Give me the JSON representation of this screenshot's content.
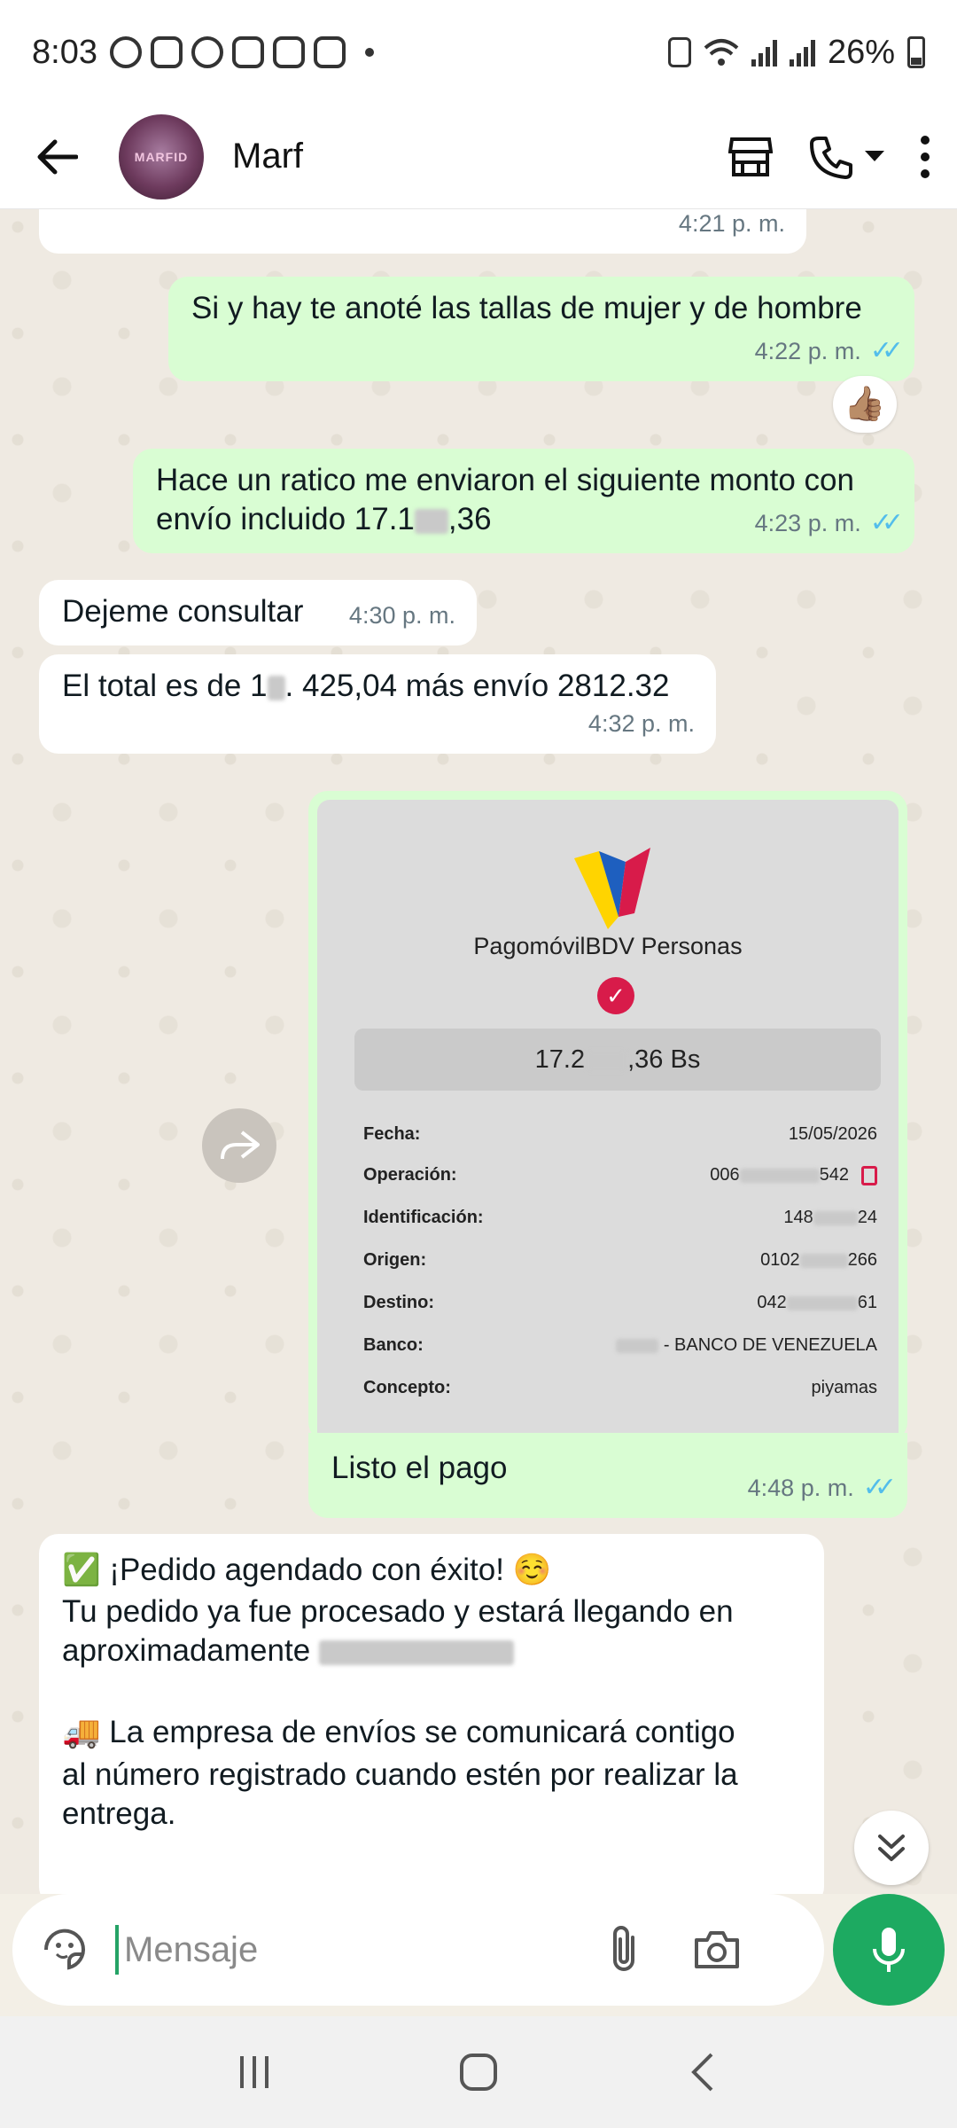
{
  "status_bar": {
    "time": "8:03",
    "battery": "26%"
  },
  "header": {
    "contact_name": "Marf",
    "avatar_text": "MARFID"
  },
  "messages": [
    {
      "type": "in",
      "text": "",
      "time": "4:21 p. m."
    },
    {
      "type": "out",
      "text": "Si y hay te anoté las tallas de mujer y de hombre",
      "time": "4:22 p. m.",
      "reaction": "👍🏽"
    },
    {
      "type": "out",
      "text_line1": "Hace un ratico me enviaron el siguiente monto con",
      "text_line2_prefix": "envío incluido 17.1",
      "text_line2_suffix": ",36",
      "time": "4:23 p. m."
    },
    {
      "type": "in",
      "text": "Dejeme consultar",
      "time": "4:30 p. m."
    },
    {
      "type": "in",
      "text_prefix": "El total es de 1",
      "text_suffix": ". 425,04 más envío 2812.32",
      "time": "4:32 p. m."
    },
    {
      "type": "in",
      "line1": "✅ ¡Pedido agendado con éxito! ☺️",
      "line2": "Tu pedido ya fue procesado y estará llegando en",
      "line3": "aproximadamente",
      "line4": "🚚 La empresa de envíos se comunicará contigo",
      "line5": "al número registrado cuando estén por realizar la",
      "line6": "entrega."
    }
  ],
  "receipt": {
    "bank_title": "PagomóvilBDV Personas",
    "amount_prefix": "17.2",
    "amount_suffix": ",36 Bs",
    "rows": [
      {
        "label": "Fecha:",
        "value": "15/05/2026"
      },
      {
        "label": "Operación:",
        "value_prefix": "006",
        "value_suffix": "542"
      },
      {
        "label": "Identificación:",
        "value_prefix": "148",
        "value_suffix": "24"
      },
      {
        "label": "Origen:",
        "value_prefix": "0102",
        "value_suffix": "266"
      },
      {
        "label": "Destino:",
        "value_prefix": "042",
        "value_suffix": "61"
      },
      {
        "label": "Banco:",
        "value_suffix": " - BANCO DE VENEZUELA"
      },
      {
        "label": "Concepto:",
        "value": "piyamas"
      }
    ],
    "caption": "Listo el pago",
    "time": "4:48 p. m."
  },
  "input": {
    "placeholder": "Mensaje"
  },
  "colors": {
    "accent": "#1daa61",
    "outgoing": "#d9fdd3",
    "incoming": "#ffffff",
    "ticks": "#53bdeb",
    "bank_red": "#d81b4a"
  }
}
